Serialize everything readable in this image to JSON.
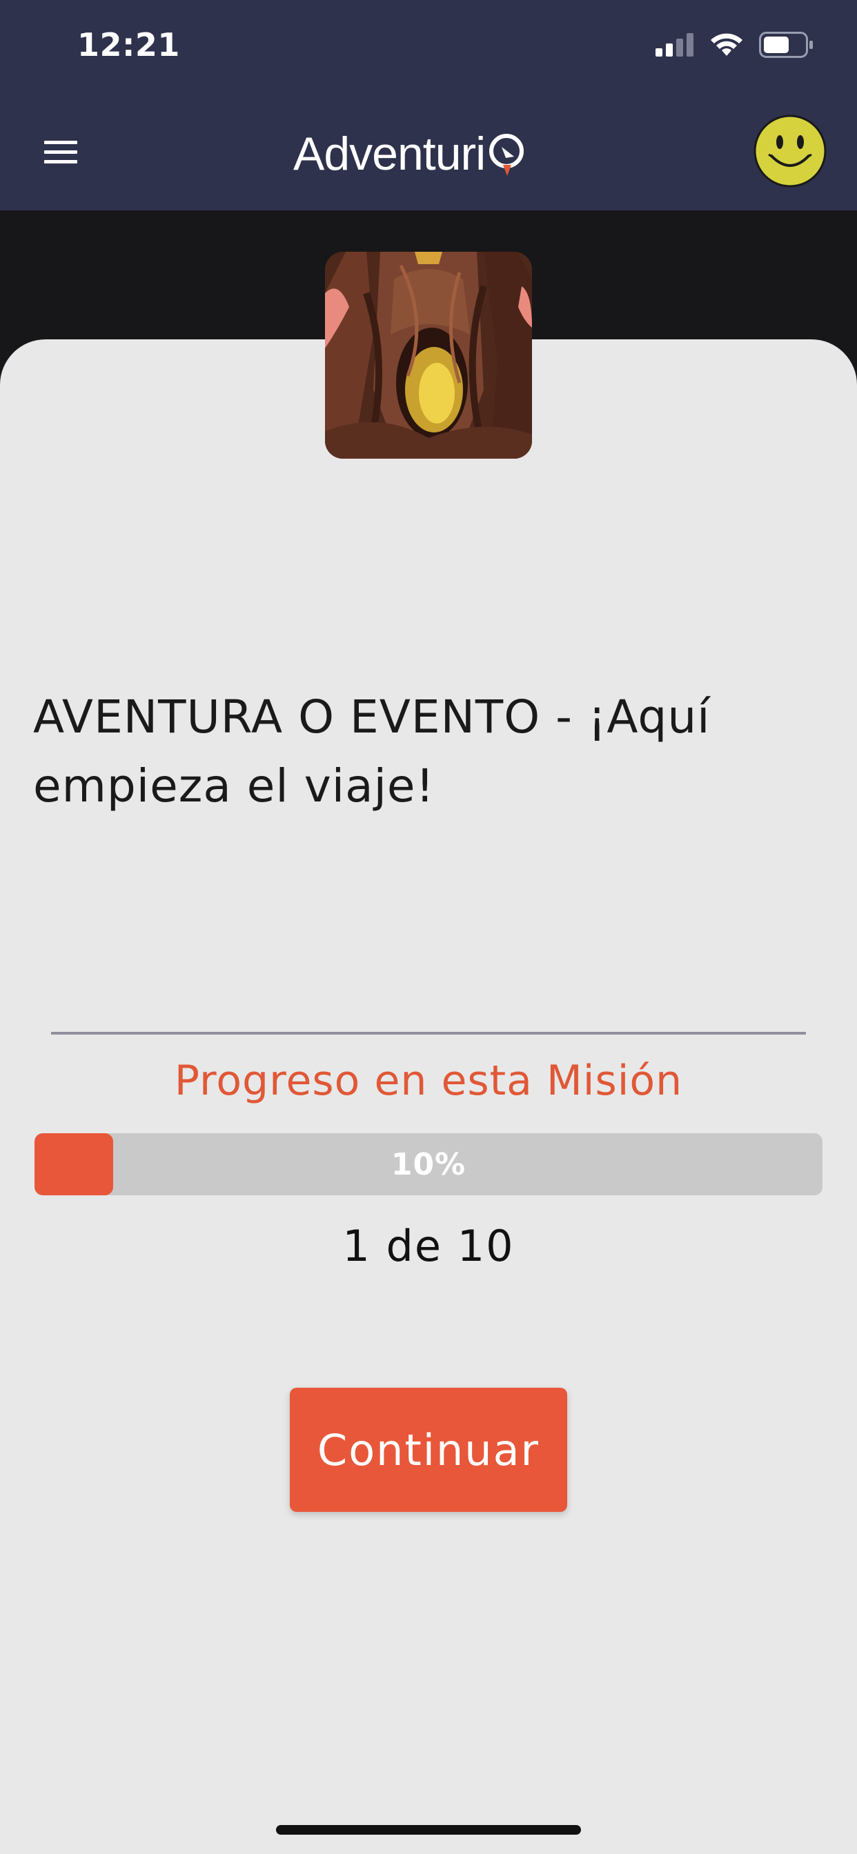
{
  "status_bar": {
    "time": "12:21",
    "signal_icon": "cellular-signal-icon",
    "wifi_icon": "wifi-icon",
    "battery_icon": "battery-icon"
  },
  "header": {
    "menu_icon": "hamburger-menu-icon",
    "brand_name": "Adventuri",
    "brand_logo_icon": "compass-pin-icon",
    "avatar_icon": "smiley-face-icon",
    "background_color": "#2e324c"
  },
  "mission": {
    "image_icon": "forest-cave-illustration",
    "title": "AVENTURA O EVENTO - ¡Aquí empieza el viaje!"
  },
  "progress": {
    "heading": "Progreso en esta Misión",
    "percent_label": "10%",
    "fraction": 0.1,
    "count_label": "1 de 10",
    "accent_color": "#e8573a"
  },
  "actions": {
    "continue_label": "Continuar"
  }
}
